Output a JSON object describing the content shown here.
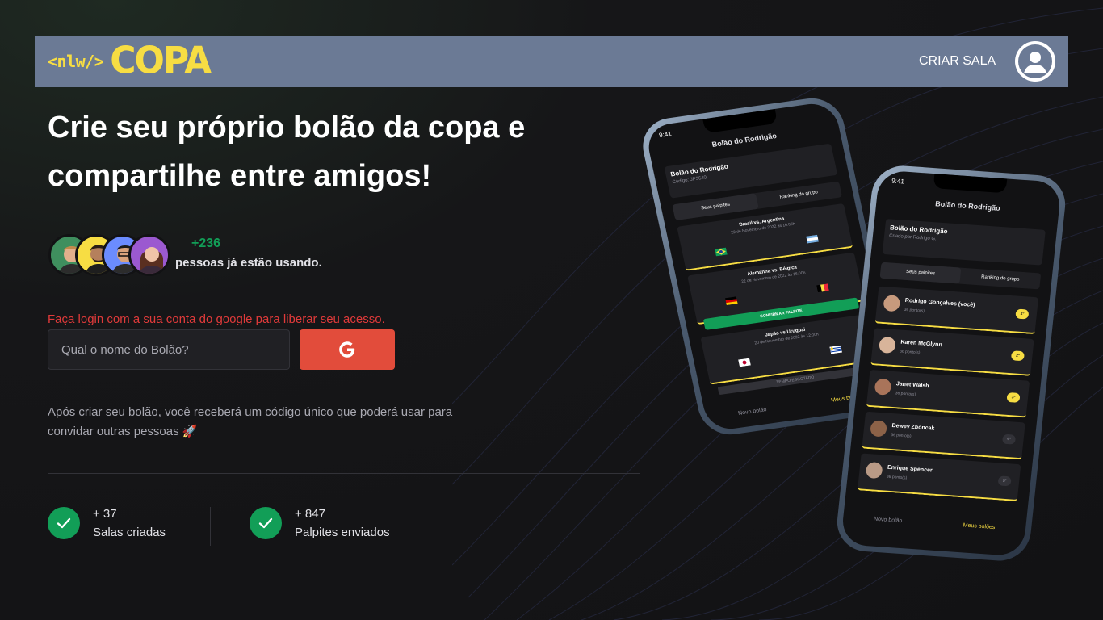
{
  "header": {
    "logo_tag": "<nlw/>",
    "logo_text": "COPA",
    "create_room": "CRIAR SALA"
  },
  "hero": {
    "title": "Crie seu próprio bolão da copa e compartilhe entre amigos!",
    "users_count": "+236",
    "users_label": "pessoas já estão usando."
  },
  "login": {
    "message": "Faça login com a sua conta do google para liberar seu acesso.",
    "input_placeholder": "Qual o nome do Bolão?"
  },
  "description": "Após criar seu bolão, você receberá um código único que poderá usar para convidar outras pessoas 🚀",
  "stats": [
    {
      "number": "+ 37",
      "label": "Salas criadas"
    },
    {
      "number": "+ 847",
      "label": "Palpites enviados"
    }
  ],
  "phone_left": {
    "time": "9:41",
    "title": "Bolão do Rodrigão",
    "pool_name": "Bolão do Rodrigão",
    "pool_code": "Código: JP3640",
    "tab1": "Seus palpites",
    "tab2": "Ranking do grupo",
    "games": [
      {
        "teams": "Brasil vs. Argentina",
        "date": "22 de Novembro de 2022 às 16:00h"
      },
      {
        "teams": "Alemanha vs. Bélgica",
        "date": "22 de Novembro de 2022 às 16:00h"
      },
      {
        "teams": "Japão vs Uruguai",
        "date": "20 de Novembro de 2022 às 12:00h"
      }
    ],
    "confirm": "CONFIRMAR PALPITE",
    "closed": "TEMPO ESGOTADO",
    "nav_new": "Novo bolão",
    "nav_mine": "Meus bolões"
  },
  "phone_right": {
    "time": "9:41",
    "title": "Bolão do Rodrigão",
    "pool_name": "Bolão do Rodrigão",
    "pool_creator": "Criado por Rodrigo G.",
    "tab1": "Seus palpites",
    "tab2": "Ranking do grupo",
    "ranking": [
      {
        "name": "Rodrigo Gonçalves (você)",
        "points": "36 ponto(s)",
        "pos": "1º"
      },
      {
        "name": "Karen McGlynn",
        "points": "36 ponto(s)",
        "pos": "2º"
      },
      {
        "name": "Janet Walsh",
        "points": "36 ponto(s)",
        "pos": "3º"
      },
      {
        "name": "Dewey Zboncak",
        "points": "36 ponto(s)",
        "pos": "4º"
      },
      {
        "name": "Enrique Spencer",
        "points": "36 ponto(s)",
        "pos": "5º"
      }
    ],
    "nav_new": "Novo bolão",
    "nav_mine": "Meus bolões"
  },
  "colors": {
    "brand_yellow": "#F7DD43",
    "success_green": "#129E57",
    "error_red": "#E03A3A",
    "google_red": "#E24C3B",
    "header_bg": "#6B7A95"
  }
}
